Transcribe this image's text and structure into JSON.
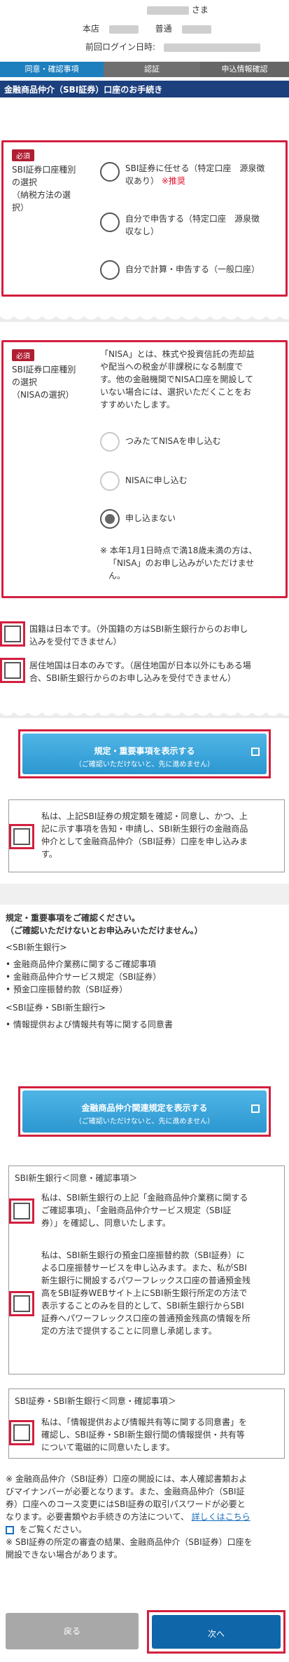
{
  "header": {
    "greeting_suffix": "さま",
    "branch": "本店",
    "account_type": "普通",
    "last_login_label": "前回ログイン日時:"
  },
  "steps": [
    "同意・確認事項",
    "認証",
    "申込情報確認"
  ],
  "page_title": "金融商品仲介（SBI証券）口座のお手続き",
  "required_badge": "必須",
  "section1": {
    "label_lines": [
      "SBI証券口座種別",
      "の選択",
      "（納税方法の選",
      "択）"
    ],
    "options": [
      {
        "text_lines": [
          "SBI証券に任せる（特定口座　源泉徴",
          "収あり）"
        ],
        "note": "※推奨"
      },
      {
        "text_lines": [
          "自分で申告する（特定口座　源泉徴",
          "収なし）"
        ],
        "note": ""
      },
      {
        "text_lines": [
          "自分で計算・申告する（一般口座）"
        ],
        "note": ""
      }
    ]
  },
  "section2": {
    "label_lines": [
      "SBI証券口座種別",
      "の選択",
      "（NISAの選択）"
    ],
    "desc_lines": [
      "「NISA」とは、株式や投資信託の売却益",
      "や配当への税金が非課税になる制度で",
      "す。他の金融機関でNISA口座を開設して",
      "いない場合には、選択いただくことをお",
      "すすめいたします。"
    ],
    "options": [
      {
        "text": "つみたてNISAを申し込む",
        "state": "disabled"
      },
      {
        "text": "NISAに申し込む",
        "state": "disabled"
      },
      {
        "text": "申し込まない",
        "state": "selected"
      }
    ],
    "note_lines": [
      "※ 本年1月1日時点で満18歳未満の方は、",
      "「NISA」のお申し込みがいただけませ",
      "ん。"
    ]
  },
  "checks_top": [
    {
      "lines": [
        "国籍は日本です。（外国籍の方はSBI新生銀行からのお申し",
        "込みを受付できません）"
      ]
    },
    {
      "lines": [
        "居住地国は日本のみです。（居住地国が日本以外にもある場",
        "合、SBI新生銀行からのお申し込みを受付できません）"
      ]
    }
  ],
  "button_rules": {
    "main": "規定・重要事項を表示する",
    "sub": "（ご確認いただけないと、先に進めません）"
  },
  "consent_main_lines": [
    "私は、上記SBI証券の規定類を確認・同意し、かつ、上",
    "記に示す事項を告知・申請し、SBI新生銀行の金融商品",
    "仲介として金融商品仲介（SBI証券）口座を申し込みま",
    "す。"
  ],
  "section_rules": {
    "title_lines": [
      "規定・重要事項をご確認ください。",
      "（ご確認いただけないとお申込みいただけません。）"
    ],
    "group1_title": "<SBI新生銀行>",
    "group1_items": [
      "金融商品仲介業務に関するご確認事項",
      "金融商品仲介サービス規定（SBI証券）",
      "預金口座振替約款（SBI証券）"
    ],
    "group2_title": "<SBI証券・SBI新生銀行>",
    "group2_items": [
      "情報提供および情報共有等に関する同意書"
    ]
  },
  "button_brokerage": {
    "main": "金融商品仲介関連規定を表示する",
    "sub": "（ご確認いただけないと、先に進めません）"
  },
  "box_shinsei": {
    "title": "SBI新生銀行＜同意・確認事項＞",
    "item1_lines": [
      "私は、SBI新生銀行の上記「金融商品仲介業務に関する",
      "ご確認事項」、「金融商品仲介サービス規定（SBI証",
      "券）」を確認し、同意いたします。"
    ],
    "item2_lines": [
      "私は、SBI新生銀行の預金口座振替約款（SBI証券）に",
      "よる口座振替サービスを申し込みます。また、私がSBI",
      "新生銀行に開設するパワーフレックス口座の普通預金残",
      "高をSBI証券WEBサイト上にSBI新生銀行所定の方法で",
      "表示することのみを目的として、SBI新生銀行からSBI",
      "証券へパワーフレックス口座の普通預金残高の情報を所",
      "定の方法で提供することに同意し承諾します。"
    ]
  },
  "box_both": {
    "title": "SBI証券・SBI新生銀行＜同意・確認事項＞",
    "item_lines": [
      "私は、「情報提供および情報共有等に関する同意書」を",
      "確認し、SBI証券・SBI新生銀行間の情報提供・共有等",
      "について電磁的に同意いたします。"
    ]
  },
  "notes_bottom": {
    "lines": [
      "※ 金融商品仲介（SBI証券）口座の開設には、本人確認書類およ",
      "びマイナンバーが必要となります。また、金融商品仲介（SBI証",
      "券）口座へのコース変更にはSBI証券の取引パスワードが必要と",
      "なります。必要書類やお手続きの方法について、",
      "をご覧ください。",
      "※ SBI証券の所定の審査の結果、金融商品仲介（SBI証券）口座を",
      "開設できない場合があります。"
    ],
    "link_text": "詳しくはこちら"
  },
  "footer": {
    "back": "戻る",
    "next": "次へ"
  },
  "colors": {
    "accent_red": "#d31f3f",
    "step_active": "#1e7fbf",
    "title_bar": "#1c3f7d",
    "primary_button": "#2b97d0",
    "next_button": "#0f66a8"
  }
}
